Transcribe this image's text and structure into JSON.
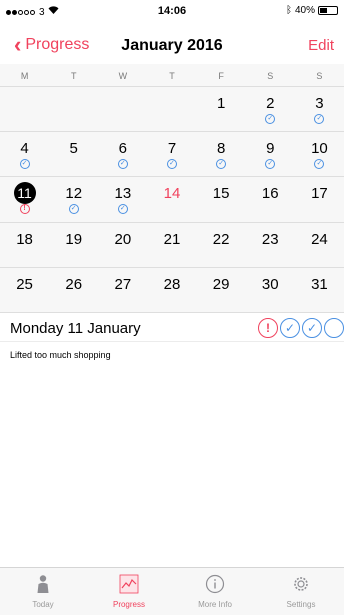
{
  "status": {
    "carrier": "3",
    "time": "14:06",
    "battery": "40%"
  },
  "nav": {
    "back_label": "Progress",
    "title": "January 2016",
    "edit_label": "Edit"
  },
  "weekdays": [
    "M",
    "T",
    "W",
    "T",
    "F",
    "S",
    "S"
  ],
  "calendar": {
    "weeks": [
      [
        {
          "d": ""
        },
        {
          "d": ""
        },
        {
          "d": ""
        },
        {
          "d": ""
        },
        {
          "d": "1"
        },
        {
          "d": "2",
          "mark": "ok"
        },
        {
          "d": "3",
          "mark": "ok"
        }
      ],
      [
        {
          "d": "4",
          "mark": "ok"
        },
        {
          "d": "5"
        },
        {
          "d": "6",
          "mark": "ok"
        },
        {
          "d": "7",
          "mark": "ok"
        },
        {
          "d": "8",
          "mark": "ok"
        },
        {
          "d": "9",
          "mark": "ok"
        },
        {
          "d": "10",
          "mark": "ok"
        }
      ],
      [
        {
          "d": "11",
          "mark": "warn",
          "selected": true
        },
        {
          "d": "12",
          "mark": "ok"
        },
        {
          "d": "13",
          "mark": "ok"
        },
        {
          "d": "14",
          "today": true
        },
        {
          "d": "15"
        },
        {
          "d": "16"
        },
        {
          "d": "17"
        }
      ],
      [
        {
          "d": "18"
        },
        {
          "d": "19"
        },
        {
          "d": "20"
        },
        {
          "d": "21"
        },
        {
          "d": "22"
        },
        {
          "d": "23"
        },
        {
          "d": "24"
        }
      ],
      [
        {
          "d": "25"
        },
        {
          "d": "26"
        },
        {
          "d": "27"
        },
        {
          "d": "28"
        },
        {
          "d": "29"
        },
        {
          "d": "30"
        },
        {
          "d": "31"
        }
      ]
    ]
  },
  "detail": {
    "date": "Monday 11 January",
    "note": "Lifted too much shopping",
    "markers": [
      "warn",
      "ok",
      "ok",
      "empty"
    ]
  },
  "tabs": [
    {
      "label": "Today",
      "icon": "person-icon",
      "active": false
    },
    {
      "label": "Progress",
      "icon": "chart-icon",
      "active": true
    },
    {
      "label": "More Info",
      "icon": "info-icon",
      "active": false
    },
    {
      "label": "Settings",
      "icon": "gear-icon",
      "active": false
    }
  ],
  "colors": {
    "accent": "#f0425d",
    "check": "#4a90e2",
    "tab_inactive": "#9a9a9a"
  }
}
